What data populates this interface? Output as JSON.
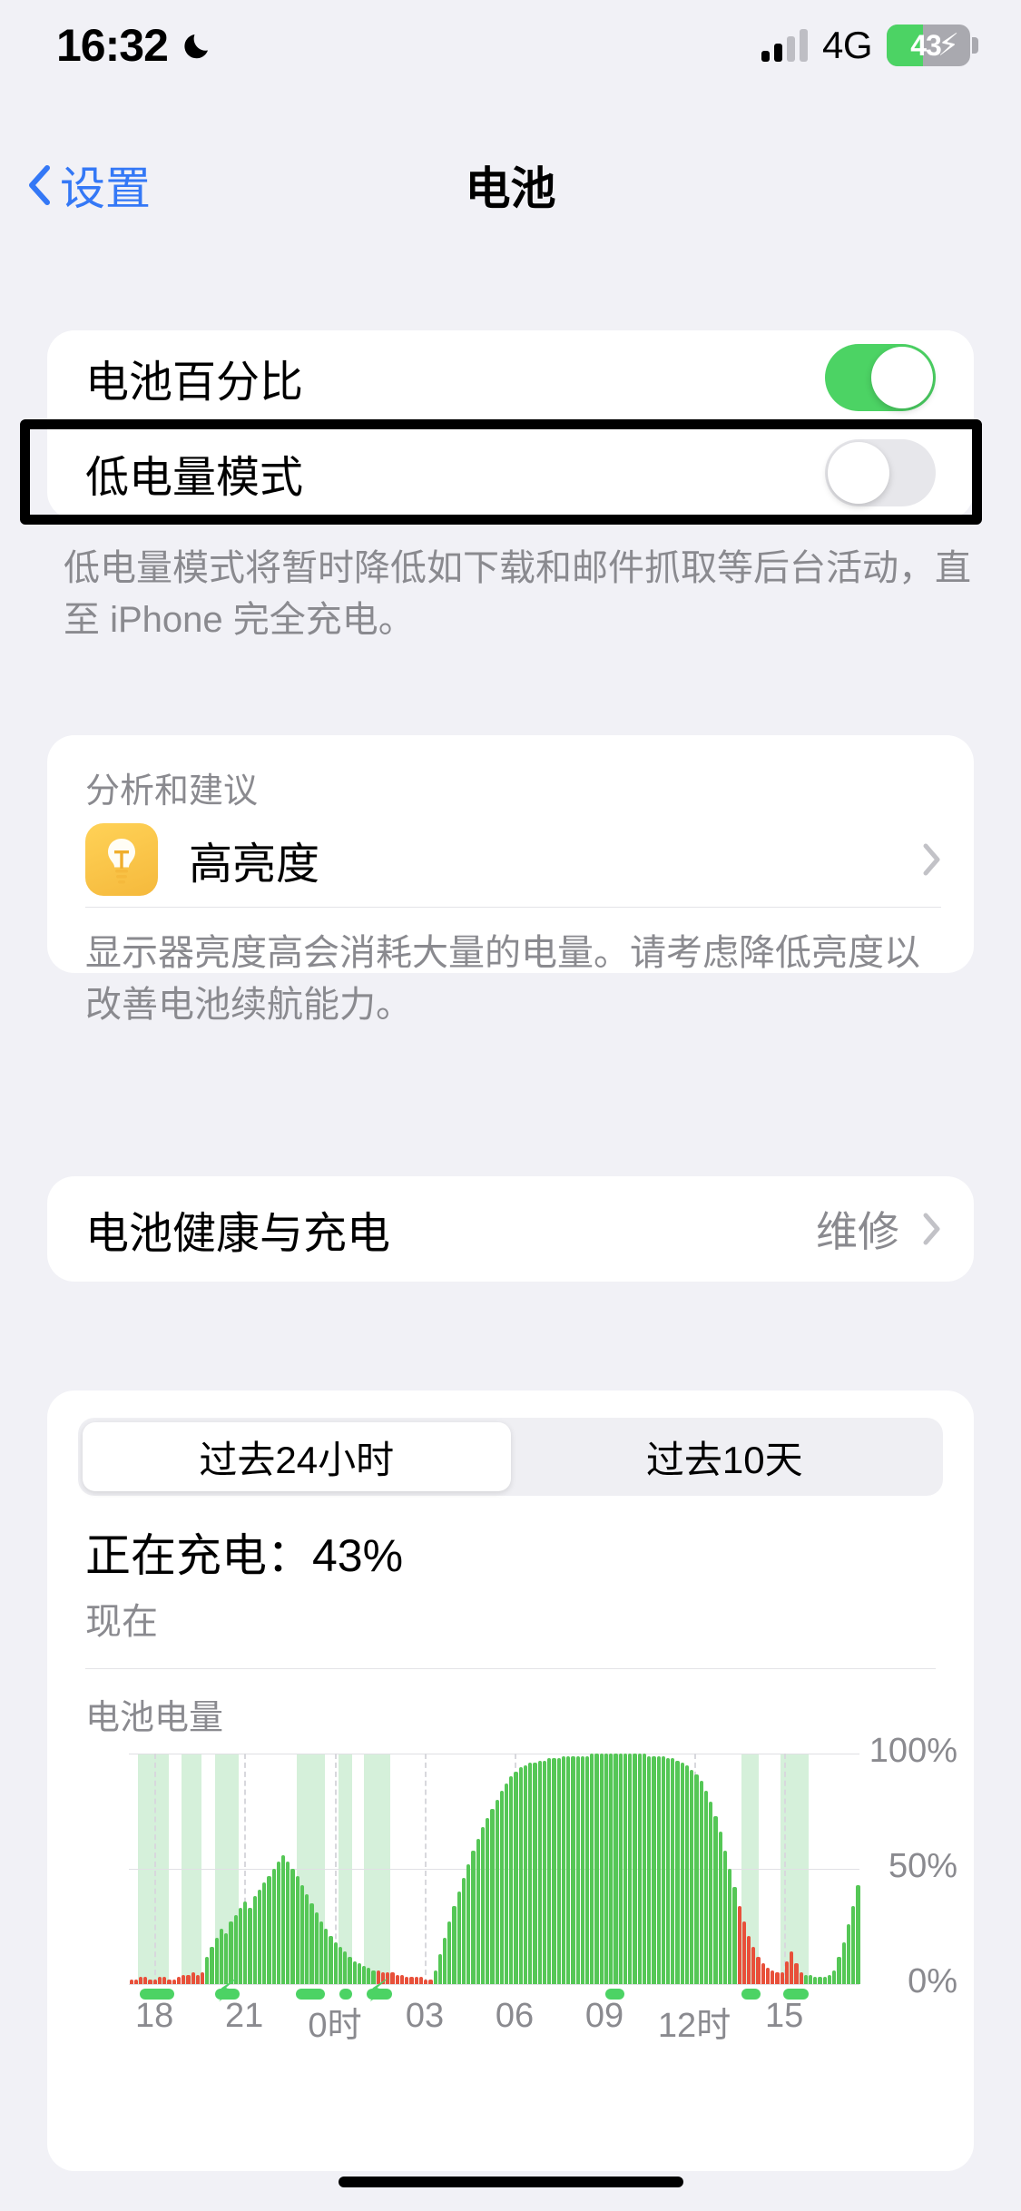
{
  "status_bar": {
    "time": "16:32",
    "moon_icon": "moon-icon",
    "network": "4G",
    "battery_percent": "43",
    "battery_charging": true,
    "battery_level": 43,
    "signal_bars_filled": 2,
    "signal_bars_total": 4
  },
  "nav": {
    "back_label": "设置",
    "title": "电池"
  },
  "toggles": {
    "battery_percentage": {
      "label": "电池百分比",
      "state": "on"
    },
    "low_power_mode": {
      "label": "低电量模式",
      "state": "off"
    },
    "footnote": "低电量模式将暂时降低如下载和邮件抓取等后台活动，直至 iPhone 完全充电。"
  },
  "analytics": {
    "header": "分析和建议",
    "item_title": "高亮度",
    "item_icon": "lightbulb-icon",
    "description": "显示器亮度高会消耗大量的电量。请考虑降低亮度以改善电池续航能力。"
  },
  "health": {
    "label": "电池健康与充电",
    "value": "维修"
  },
  "usage": {
    "segments": [
      {
        "label": "过去24小时",
        "active": true
      },
      {
        "label": "过去10天",
        "active": false
      }
    ],
    "status_line": "正在充电：43%",
    "status_sub": "现在",
    "chart_label": "电池电量"
  },
  "colors": {
    "accent_blue": "#3478F6",
    "toggle_on_green": "#4CD364",
    "toggle_off_gray": "#E7E7EB",
    "bar_green": "#55C756",
    "bar_red": "#E8503A",
    "charging_shade": "#D5F0DA",
    "secondary_text": "#8A8A8F",
    "card_bg": "#FFFFFF",
    "page_bg": "#F1F1F6",
    "bulb_icon_yellow": "#F5B93C",
    "highlight_box": "#000000"
  },
  "chart_data": {
    "type": "bar",
    "title": "电池电量",
    "xlabel": "",
    "ylabel": "",
    "ylim": [
      0,
      100
    ],
    "ytick_labels": [
      "100%",
      "50%",
      "0%"
    ],
    "ytick_values": [
      100,
      50,
      0
    ],
    "xtick_labels": [
      "18",
      "21",
      "0时",
      "03",
      "06",
      "09",
      "12时",
      "15"
    ],
    "xtick_positions": [
      0.035,
      0.158,
      0.282,
      0.405,
      0.528,
      0.651,
      0.774,
      0.897
    ],
    "grid": true,
    "legend": "none",
    "series": [
      {
        "name": "电池电量",
        "color": "#55C756",
        "values": [
          2,
          2,
          3,
          3,
          2,
          2,
          3,
          3,
          2,
          2,
          3,
          4,
          4,
          5,
          4,
          5,
          12,
          16,
          20,
          24,
          22,
          27,
          30,
          33,
          36,
          33,
          38,
          41,
          44,
          47,
          50,
          53,
          56,
          53,
          50,
          47,
          43,
          39,
          35,
          31,
          27,
          24,
          21,
          18,
          16,
          14,
          12,
          10,
          9,
          8,
          7,
          6,
          6,
          5,
          5,
          5,
          4,
          4,
          3,
          3,
          3,
          3,
          2,
          2,
          6,
          13,
          20,
          27,
          34,
          40,
          46,
          52,
          58,
          63,
          68,
          72,
          76,
          80,
          84,
          87,
          90,
          92,
          94,
          95,
          96,
          96,
          97,
          97,
          98,
          98,
          98,
          99,
          99,
          99,
          99,
          99,
          99,
          100,
          100,
          100,
          100,
          100,
          100,
          100,
          100,
          100,
          100,
          100,
          100,
          99,
          99,
          99,
          99,
          98,
          98,
          97,
          96,
          95,
          93,
          91,
          88,
          84,
          79,
          73,
          66,
          58,
          50,
          42,
          34,
          27,
          21,
          16,
          12,
          9,
          7,
          6,
          5,
          5,
          10,
          14,
          9,
          5,
          4,
          4,
          3,
          3,
          3,
          4,
          6,
          12,
          18,
          26,
          34,
          43
        ]
      }
    ],
    "red_bar_indices": [
      0,
      1,
      2,
      3,
      4,
      5,
      6,
      7,
      8,
      9,
      10,
      11,
      12,
      13,
      14,
      15,
      52,
      53,
      54,
      55,
      56,
      57,
      58,
      59,
      60,
      61,
      62,
      63,
      128,
      129,
      130,
      131,
      132,
      133,
      134,
      135,
      136,
      137,
      138,
      139,
      140,
      141
    ],
    "charging_shaded_ranges": [
      [
        0.012,
        0.055
      ],
      [
        0.072,
        0.1
      ],
      [
        0.118,
        0.15
      ],
      [
        0.23,
        0.268
      ],
      [
        0.287,
        0.305
      ],
      [
        0.322,
        0.358
      ],
      [
        0.65,
        0.675
      ],
      [
        0.838,
        0.862
      ],
      [
        0.892,
        0.93
      ]
    ],
    "charging_strips": [
      {
        "start": 0.015,
        "end": 0.062
      },
      {
        "start": 0.118,
        "end": 0.152
      },
      {
        "start": 0.228,
        "end": 0.268
      },
      {
        "start": 0.288,
        "end": 0.305
      },
      {
        "start": 0.325,
        "end": 0.36
      },
      {
        "start": 0.652,
        "end": 0.678
      },
      {
        "start": 0.838,
        "end": 0.864
      },
      {
        "start": 0.896,
        "end": 0.93
      }
    ],
    "charging_bolts": [
      0.135,
      0.342
    ]
  }
}
